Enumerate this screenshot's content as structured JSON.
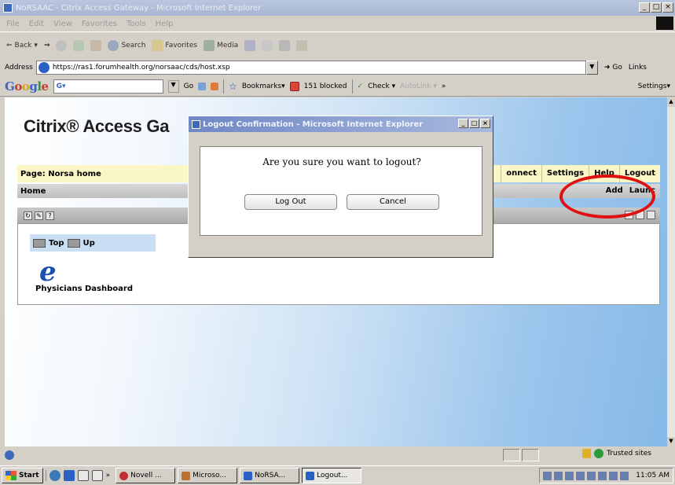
{
  "window": {
    "title": "NoRSAAC - Citrix Access Gateway - Microsoft Internet Explorer",
    "controls": [
      "_",
      "□",
      "×"
    ]
  },
  "menu": [
    "File",
    "Edit",
    "View",
    "Favorites",
    "Tools",
    "Help"
  ],
  "toolbar": {
    "back": "Back",
    "search": "Search",
    "favorites": "Favorites",
    "media": "Media"
  },
  "address": {
    "label": "Address",
    "url": "https://ras1.forumhealth.org/norsaac/cds/host.xsp",
    "go": "Go",
    "links": "Links"
  },
  "google_bar": {
    "search_value": "G▾",
    "go": "Go",
    "bookmarks": "Bookmarks▾",
    "blocked": "151 blocked",
    "check": "Check ▾",
    "autolink": "AutoLink ▾",
    "more": "»",
    "settings": "Settings▾"
  },
  "page": {
    "brand": "Citrix® Access Ga",
    "page_label": "Page: Norsa home",
    "nav": [
      "onnect",
      "Settings",
      "Help",
      "Logout"
    ],
    "home": "Home",
    "home_actions": [
      "Add",
      "Launc"
    ],
    "folder_top": "Top",
    "folder_up": "Up",
    "app_label": "Physicians Dashboard"
  },
  "dialog": {
    "title": "Logout Confirmation - Microsoft Internet Explorer",
    "message": "Are you sure you want to logout?",
    "logout_label": "Log Out",
    "cancel_label": "Cancel"
  },
  "status": {
    "zone": "Trusted sites"
  },
  "taskbar": {
    "start": "Start",
    "tasks": [
      {
        "label": "Novell ...",
        "active": false
      },
      {
        "label": "Microso...",
        "active": false
      },
      {
        "label": "NoRSA...",
        "active": false
      },
      {
        "label": "Logout...",
        "active": true
      }
    ],
    "clock": "11:05 AM"
  },
  "colors": {
    "highlight_circle": "#e01010",
    "page_bar": "#fbf6c6",
    "folder_bar": "#c9def2"
  }
}
